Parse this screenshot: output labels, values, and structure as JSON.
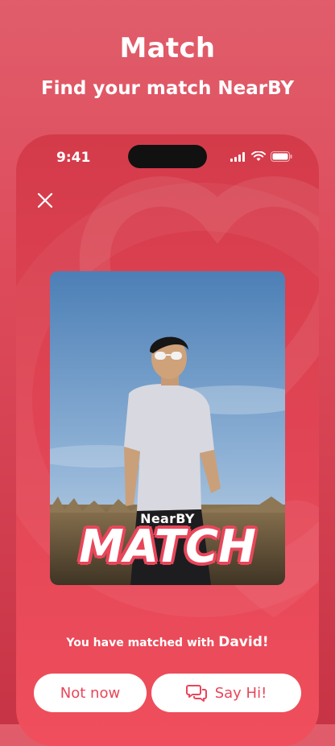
{
  "promo": {
    "title": "Match",
    "subtitle": "Find your match NearBY"
  },
  "status_bar": {
    "time": "9:41"
  },
  "card": {
    "brand": "NearBY",
    "headline": "MATCH"
  },
  "message": {
    "text": "You have matched with",
    "name": "David!"
  },
  "actions": {
    "not_now_label": "Not now",
    "say_hi_label": "Say Hi!"
  },
  "colors": {
    "accent": "#e8465a",
    "background": "#dd4a5a"
  },
  "icons": {
    "close": "close-icon",
    "chat": "chat-bubbles-icon"
  }
}
